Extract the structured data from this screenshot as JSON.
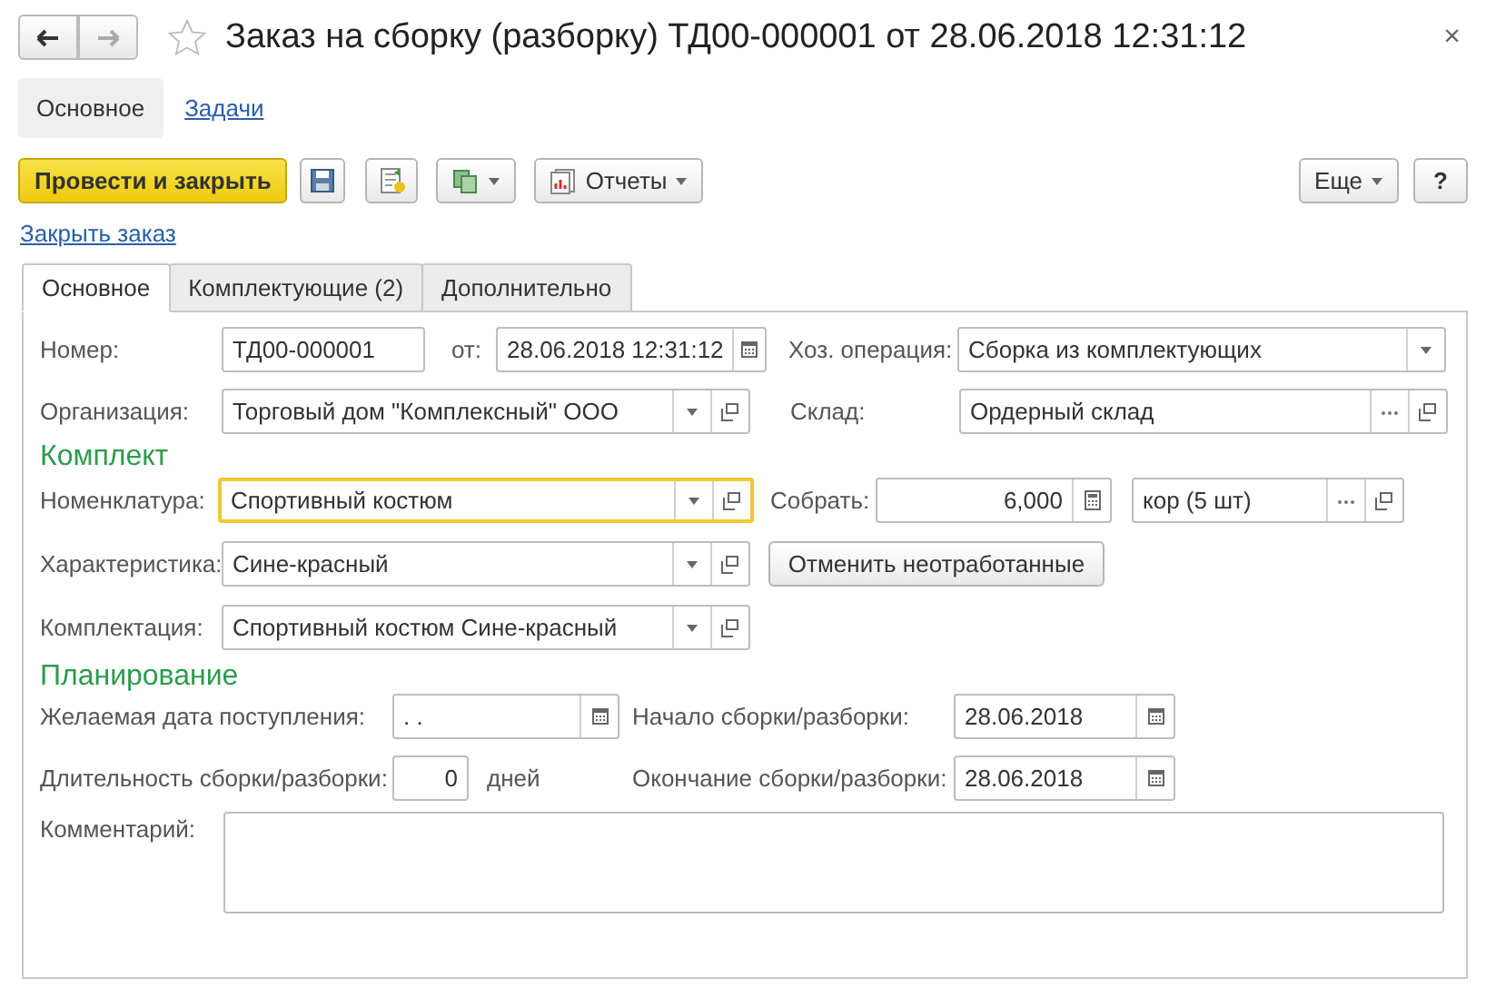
{
  "window": {
    "title": "Заказ на сборку (разборку) ТД00-000001 от 28.06.2018 12:31:12",
    "close": "×"
  },
  "nav": [
    {
      "label": "Основное",
      "selected": true
    },
    {
      "label": "Задачи",
      "selected": false
    }
  ],
  "toolbar": {
    "primary": "Провести и закрыть",
    "reports": "Отчеты",
    "more": "Еще",
    "help": "?"
  },
  "close_order_link": "Закрыть заказ",
  "tabs": [
    {
      "label": "Основное",
      "selected": true
    },
    {
      "label": "Комплектующие (2)",
      "selected": false
    },
    {
      "label": "Дополнительно",
      "selected": false
    }
  ],
  "main": {
    "number_label": "Номер:",
    "number": "ТД00-000001",
    "date_label": "от:",
    "date": "28.06.2018 12:31:12",
    "operation_label": "Хоз. операция:",
    "operation": "Сборка из комплектующих",
    "org_label": "Организация:",
    "org": "Торговый дом \"Комплексный\" ООО",
    "warehouse_label": "Склад:",
    "warehouse": "Ордерный склад"
  },
  "kit": {
    "header": "Комплект",
    "item_label": "Номенклатура:",
    "item": "Спортивный костюм",
    "item_focused": true,
    "assemble_label": "Собрать:",
    "quantity": "6,000",
    "unit": "кор (5 шт)",
    "characteristic_label": "Характеристика:",
    "characteristic": "Сине-красный",
    "cancel_button": "Отменить неотработанные",
    "set_label": "Комплектация:",
    "set": "Спортивный костюм Сине-красный"
  },
  "planning": {
    "header": "Планирование",
    "desired_label": "Желаемая дата поступления:",
    "desired": " .  .",
    "start_label": "Начало сборки/разборки:",
    "start": "28.06.2018",
    "duration_label": "Длительность сборки/разборки:",
    "duration": "0",
    "days": "дней",
    "end_label": "Окончание сборки/разборки:",
    "end": "28.06.2018"
  },
  "comment_label": "Комментарий:"
}
